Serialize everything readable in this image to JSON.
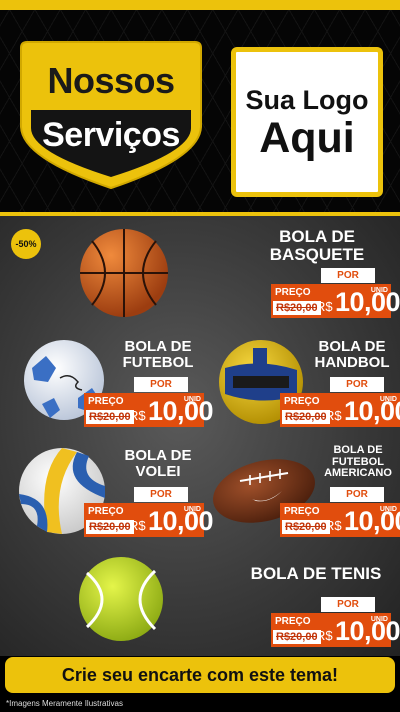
{
  "header": {
    "badge_line1": "Nossos",
    "badge_line2": "Serviços",
    "logo_line1": "Sua Logo",
    "logo_line2": "Aqui"
  },
  "discount_badge": "-50%",
  "products": [
    {
      "title_line1": "BOLA DE",
      "title_line2": "BASQUETE",
      "por": "POR",
      "preco": "PREÇO",
      "old_price": "R$20,00",
      "currency": "R$",
      "price": "10,00",
      "unit": "UNID",
      "icon": "basketball-icon"
    },
    {
      "title_line1": "BOLA DE",
      "title_line2": "FUTEBOL",
      "por": "POR",
      "preco": "PREÇO",
      "old_price": "R$20,00",
      "currency": "R$",
      "price": "10,00",
      "unit": "UNID",
      "icon": "soccer-ball-icon"
    },
    {
      "title_line1": "BOLA DE",
      "title_line2": "HANDBOL",
      "por": "POR",
      "preco": "PREÇO",
      "old_price": "R$20,00",
      "currency": "R$",
      "price": "10,00",
      "unit": "UNID",
      "icon": "handball-icon"
    },
    {
      "title_line1": "BOLA DE",
      "title_line2": "VOLEI",
      "por": "POR",
      "preco": "PREÇO",
      "old_price": "R$20,00",
      "currency": "R$",
      "price": "10,00",
      "unit": "UNID",
      "icon": "volleyball-icon"
    },
    {
      "title_line1": "BOLA DE",
      "title_line2": "FUTEBOL",
      "title_line3": "AMERICANO",
      "por": "POR",
      "preco": "PREÇO",
      "old_price": "R$20,00",
      "currency": "R$",
      "price": "10,00",
      "unit": "UNID",
      "icon": "american-football-icon"
    },
    {
      "title_line1": "BOLA DE TENIS",
      "por": "POR",
      "preco": "PREÇO",
      "old_price": "R$20,00",
      "currency": "R$",
      "price": "10,00",
      "unit": "UNID",
      "icon": "tennis-ball-icon"
    }
  ],
  "cta": "Crie seu encarte com este tema!",
  "footer_note": "*Imagens Meramente Ilustrativas",
  "colors": {
    "yellow": "#ecc20c",
    "orange": "#e14d0d",
    "dark": "#111111"
  }
}
